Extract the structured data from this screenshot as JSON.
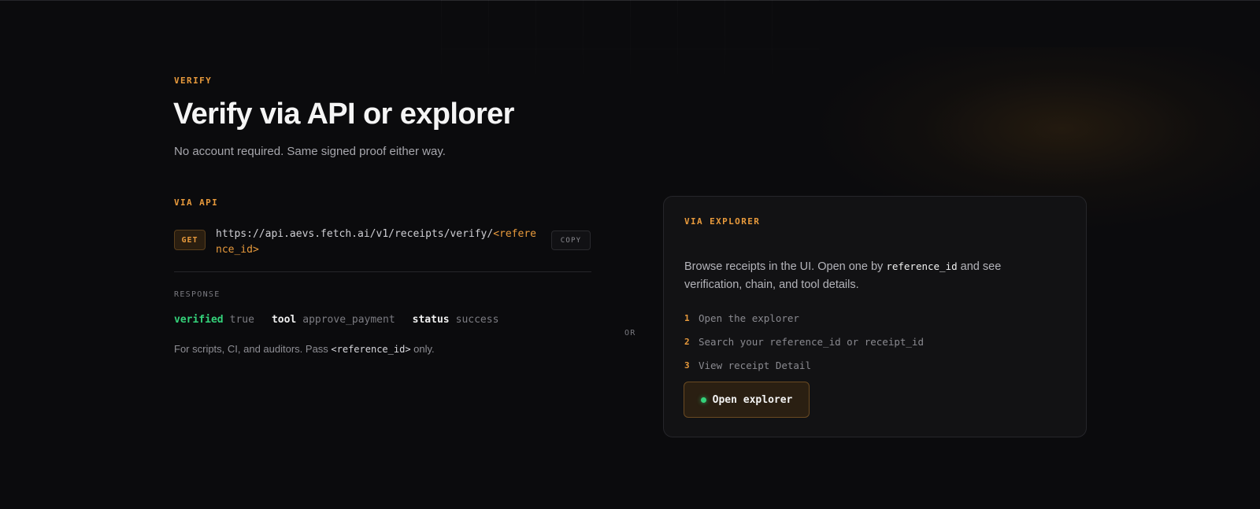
{
  "section": {
    "eyebrow": "VERIFY",
    "title": "Verify via API or explorer",
    "subtitle": "No account required. Same signed proof either way."
  },
  "api": {
    "label": "VIA API",
    "method": "GET",
    "url_base": "https://api.aevs.fetch.ai/v1/receipts/verify/",
    "url_param": "<reference_id>",
    "copy_label": "COPY",
    "response_label": "RESPONSE",
    "response": [
      {
        "key": "verified",
        "value": "true"
      },
      {
        "key": "tool",
        "value": "approve_payment"
      },
      {
        "key": "status",
        "value": "success"
      }
    ],
    "note_prefix": "For scripts, CI, and auditors. Pass ",
    "note_code": "<reference_id>",
    "note_suffix": " only."
  },
  "or_label": "OR",
  "explorer": {
    "label": "VIA EXPLORER",
    "desc_prefix": "Browse receipts in the UI. Open one by ",
    "desc_code": "reference_id",
    "desc_suffix": " and see verification, chain, and tool details.",
    "steps": [
      {
        "num": "1",
        "text": "Open the explorer"
      },
      {
        "num": "2",
        "text": "Search your reference_id or receipt_id"
      },
      {
        "num": "3",
        "text": "View receipt Detail"
      }
    ],
    "button_label": "Open explorer"
  },
  "colors": {
    "accent": "#e89a3c",
    "success": "#34d27a",
    "background": "#0b0b0d",
    "card": "#121214"
  }
}
